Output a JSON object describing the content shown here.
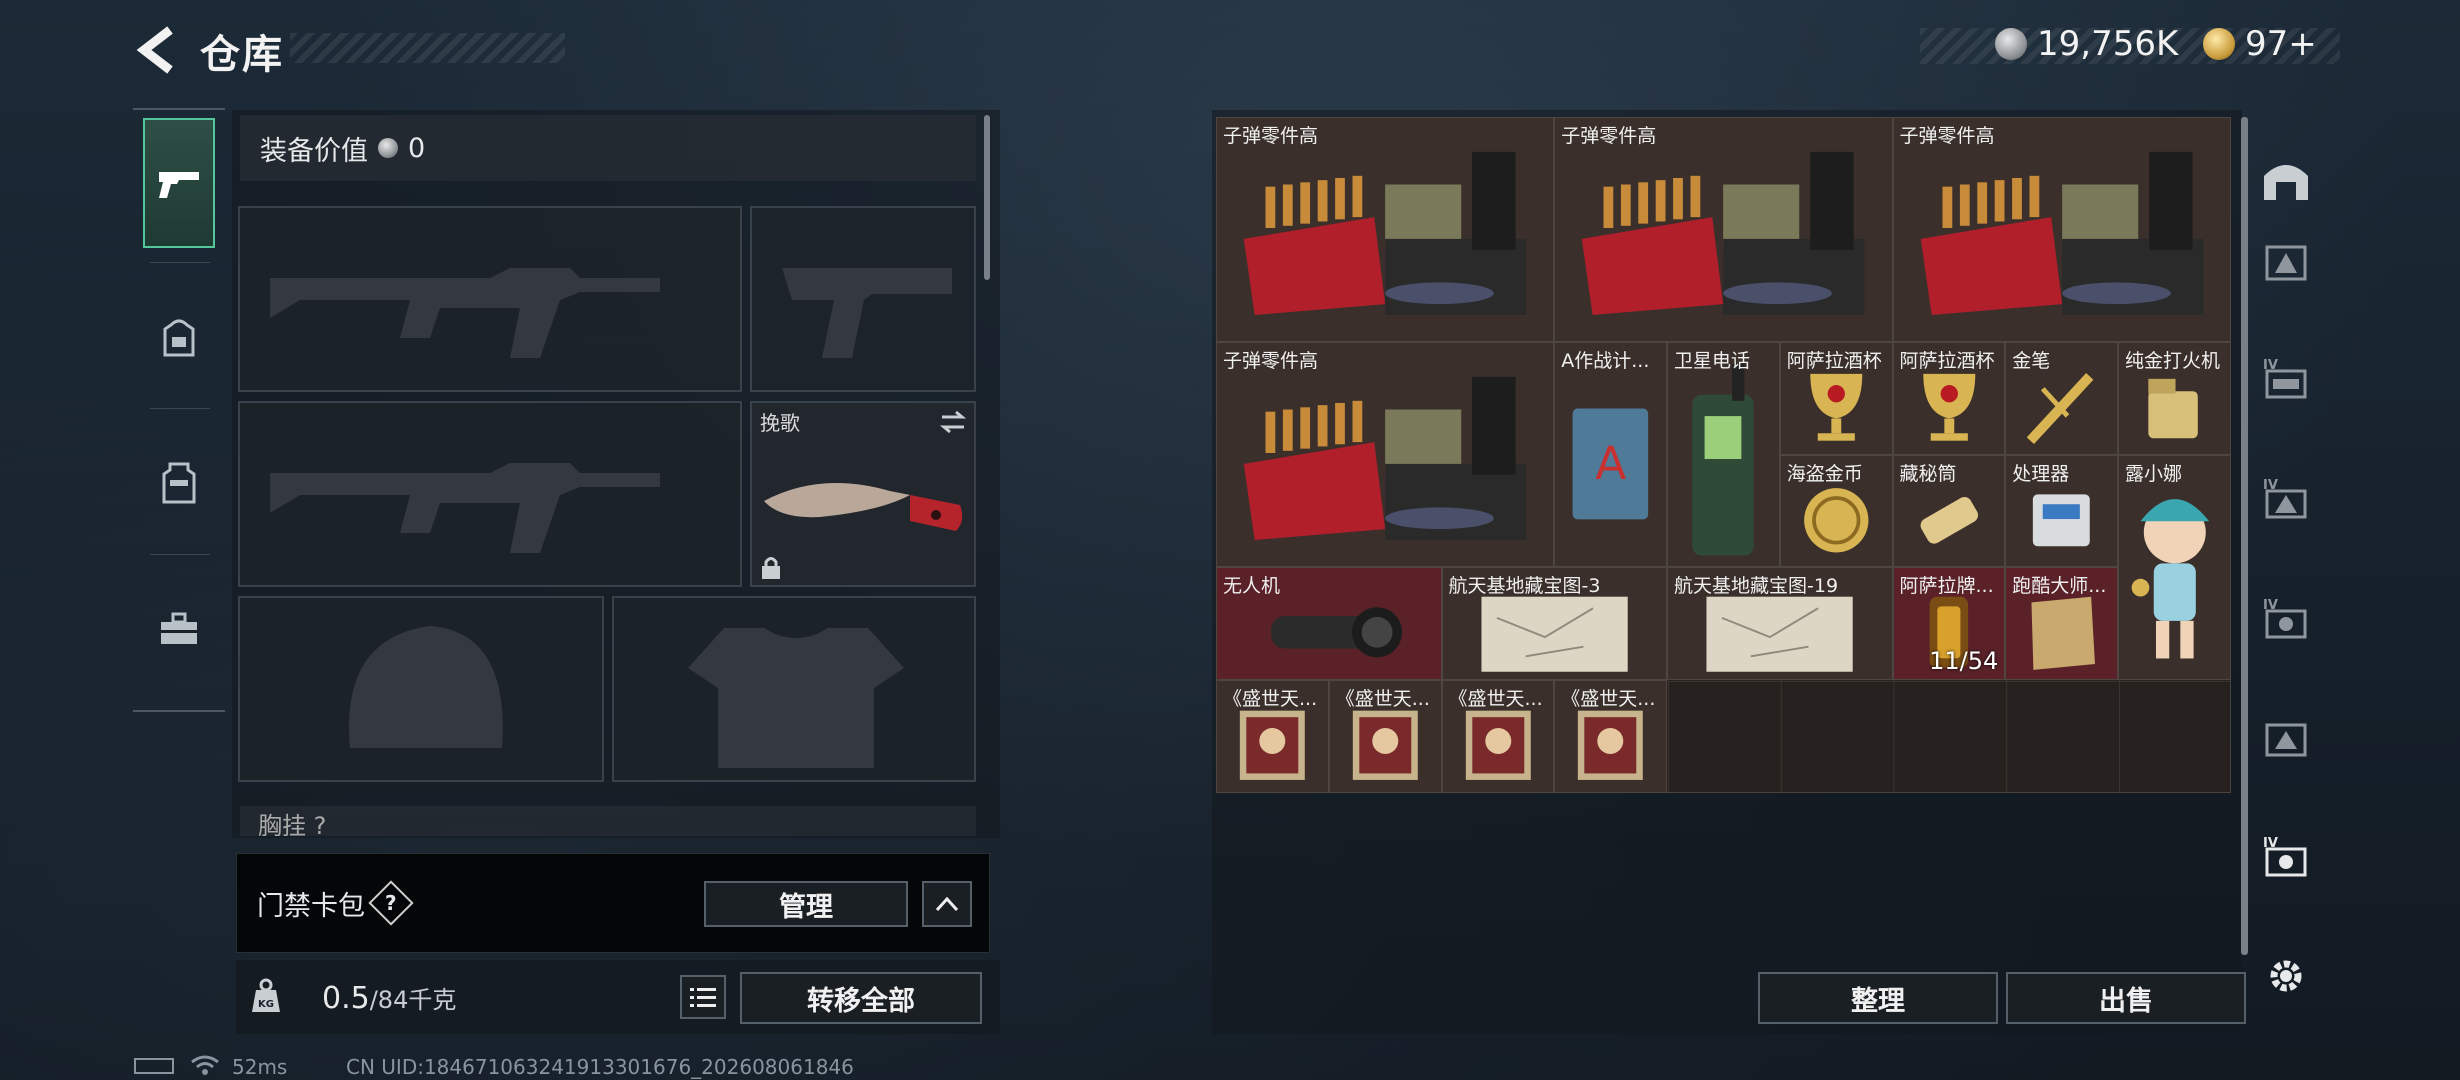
{
  "header": {
    "title": "仓库",
    "currency_silver": "19,756K",
    "currency_gold": "97+"
  },
  "categories": [
    {
      "name": "pistol-icon"
    },
    {
      "name": "backpack-icon"
    },
    {
      "name": "vest-icon"
    },
    {
      "name": "toolbox-icon"
    }
  ],
  "loadout": {
    "equip_value_label": "装备价值",
    "equip_value": "0",
    "melee_label": "挽歌",
    "next_section_label": "胸挂 ?"
  },
  "card_pack": {
    "label": "门禁卡包",
    "help": "?",
    "manage_button": "管理"
  },
  "weight": {
    "current": "0.5",
    "capacity": "/84千克",
    "transfer_all": "转移全部"
  },
  "storage": {
    "items": [
      {
        "label": "子弹零件高"
      },
      {
        "label": "子弹零件高"
      },
      {
        "label": "子弹零件高"
      },
      {
        "label": "子弹零件高"
      },
      {
        "label": "A作战计..."
      },
      {
        "label": "卫星电话"
      },
      {
        "label": "阿萨拉酒杯"
      },
      {
        "label": "阿萨拉酒杯"
      },
      {
        "label": "金笔"
      },
      {
        "label": "纯金打火机"
      },
      {
        "label": "海盗金币"
      },
      {
        "label": "藏秘筒"
      },
      {
        "label": "处理器"
      },
      {
        "label": "露小娜"
      },
      {
        "label": "无人机"
      },
      {
        "label": "航天基地藏宝图-3"
      },
      {
        "label": "航天基地藏宝图-19"
      },
      {
        "label": "阿萨拉牌...",
        "count": "11/54"
      },
      {
        "label": "跑酷大师..."
      },
      {
        "label": "《盛世天..."
      },
      {
        "label": "《盛世天..."
      },
      {
        "label": "《盛世天..."
      },
      {
        "label": "《盛世天..."
      }
    ],
    "sort_button": "整理",
    "sell_button": "出售"
  },
  "status_bar": {
    "ping": "52ms",
    "uid": "CN UID:18467106324191330167­6_202608061846"
  },
  "colors": {
    "accent_green": "#55c59a",
    "grid_bg": "#26211e",
    "item_red": "#5a2228"
  }
}
